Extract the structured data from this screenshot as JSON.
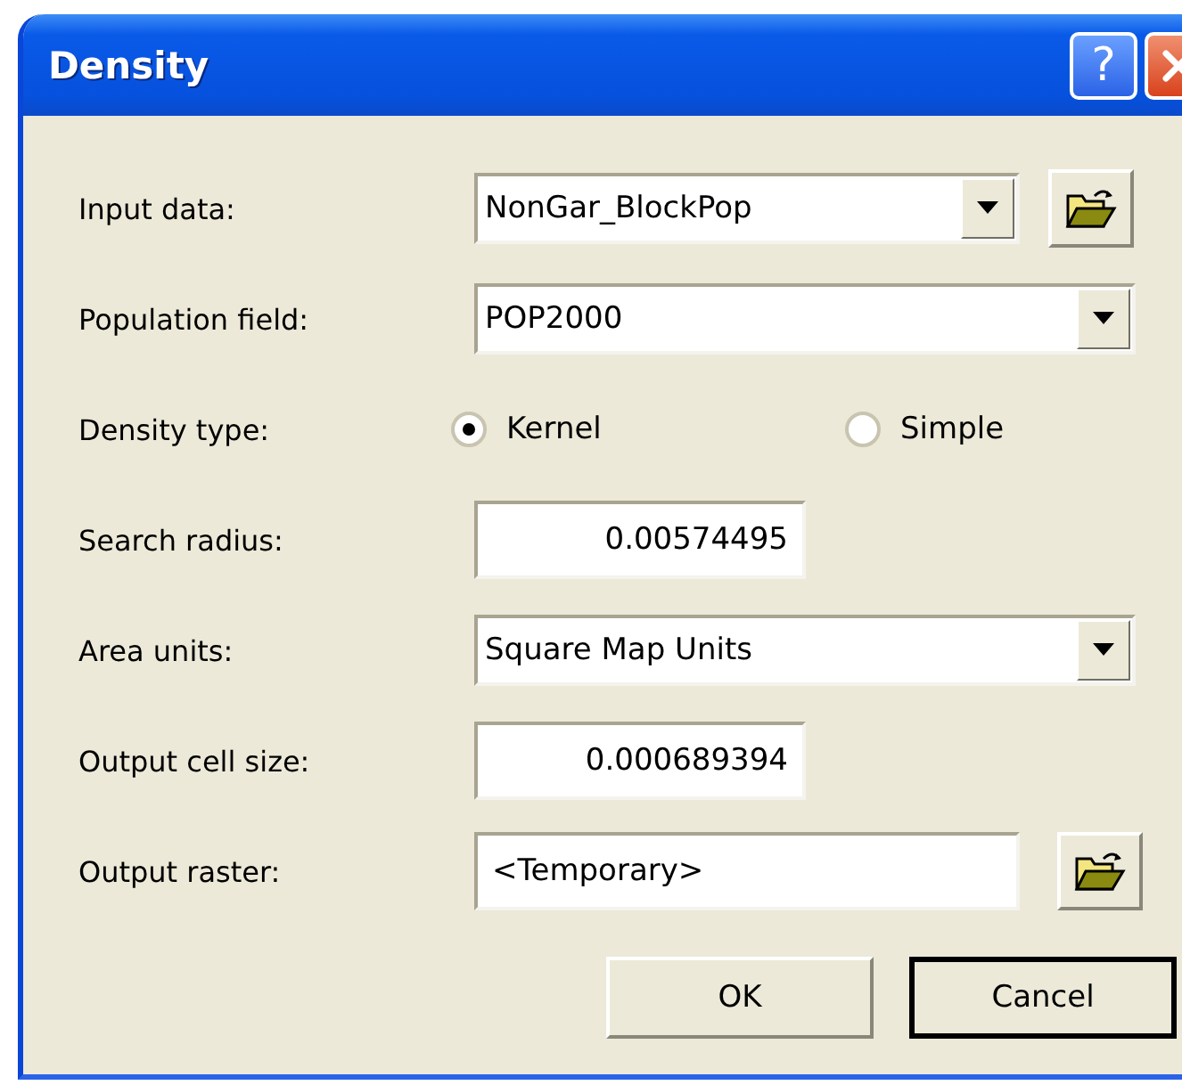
{
  "window": {
    "title": "Density",
    "help_button": "?"
  },
  "rows": [
    {
      "label": "Input data:",
      "kind": "combo",
      "value": "NonGar_BlockPop",
      "browse": true
    },
    {
      "label": "Population field:",
      "kind": "combo",
      "value": "POP2000",
      "browse": false
    },
    {
      "label": "Density type:",
      "kind": "radio",
      "options": [
        {
          "label": "Kernel",
          "selected": true
        },
        {
          "label": "Simple",
          "selected": false
        }
      ]
    },
    {
      "label": "Search radius:",
      "kind": "text",
      "value": "0.00574495",
      "browse": false
    },
    {
      "label": "Area units:",
      "kind": "combo",
      "value": "Square Map Units",
      "browse": false
    },
    {
      "label": "Output cell size:",
      "kind": "text",
      "value": "0.000689394",
      "browse": false
    },
    {
      "label": "Output raster:",
      "kind": "text",
      "value": "<Temporary>",
      "browse": true
    }
  ],
  "buttons": [
    {
      "label": "OK",
      "default": false
    },
    {
      "label": "Cancel",
      "default": true
    }
  ]
}
